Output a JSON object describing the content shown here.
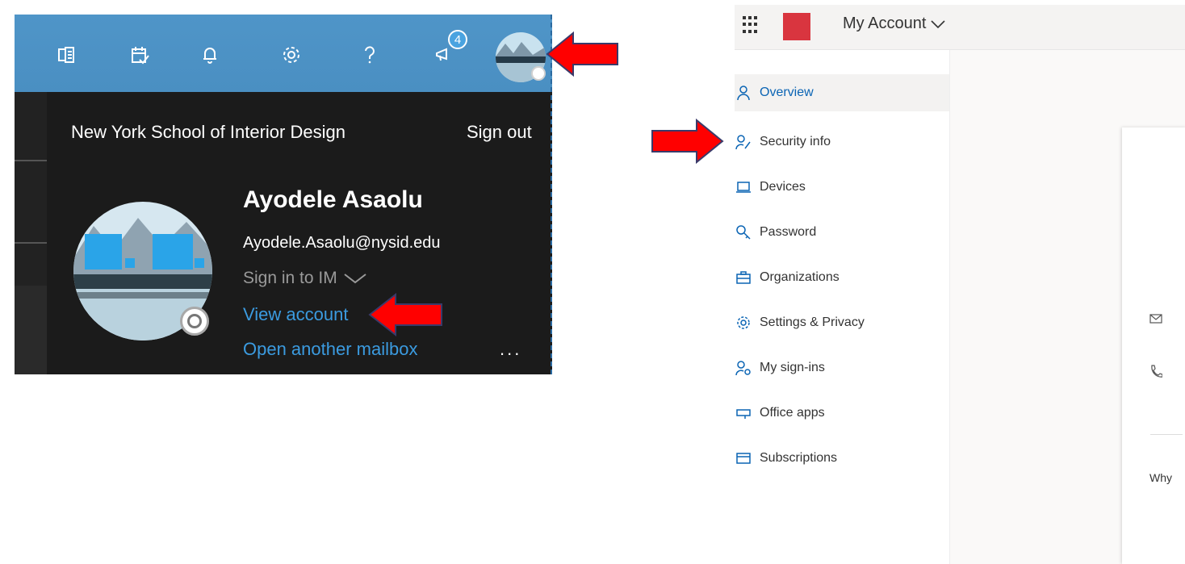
{
  "outlook_flyout": {
    "notification_count": "4",
    "organization": "New York School of Interior Design",
    "sign_out_label": "Sign out",
    "user_name": "Ayodele Asaolu",
    "user_email": "Ayodele.Asaolu@nysid.edu",
    "im_label": "Sign in to IM",
    "view_account_label": "View account",
    "open_mailbox_label": "Open another mailbox",
    "more_label": "...",
    "topbar_icons": [
      "onenote-icon",
      "calendar-check-icon",
      "bell-icon",
      "gear-icon",
      "help-icon",
      "megaphone-icon"
    ]
  },
  "portal": {
    "app_title": "My Account",
    "nav": [
      {
        "label": "Overview",
        "icon": "person-icon",
        "active": true
      },
      {
        "label": "Security info",
        "icon": "person-key-icon",
        "active": false
      },
      {
        "label": "Devices",
        "icon": "laptop-icon",
        "active": false
      },
      {
        "label": "Password",
        "icon": "key-icon",
        "active": false
      },
      {
        "label": "Organizations",
        "icon": "briefcase-icon",
        "active": false
      },
      {
        "label": "Settings & Privacy",
        "icon": "gear-icon",
        "active": false
      },
      {
        "label": "My sign-ins",
        "icon": "person-key-icon",
        "active": false
      },
      {
        "label": "Office apps",
        "icon": "apps-icon",
        "active": false
      },
      {
        "label": "Subscriptions",
        "icon": "card-icon",
        "active": false
      }
    ],
    "card_text": "Why"
  },
  "colors": {
    "outlook_topbar": "#4f95c8",
    "outlook_bg": "#1b1b1b",
    "link": "#3b9be0",
    "active_nav": "#0a64b4",
    "arrow": "#e00000"
  }
}
